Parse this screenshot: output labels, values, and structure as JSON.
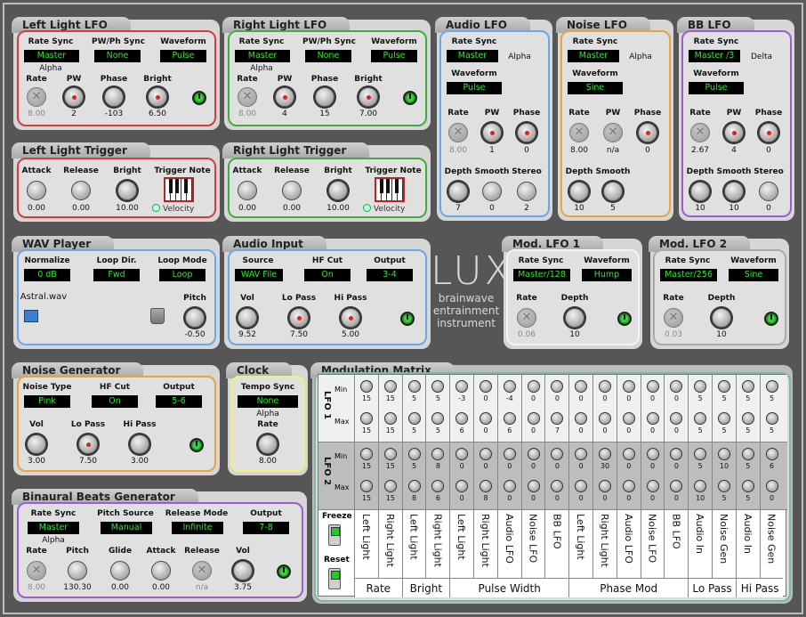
{
  "left_lfo": {
    "title": "Left Light LFO",
    "rate_sync_label": "Rate Sync",
    "rate_sync": "Master",
    "pwph_label": "PW/Ph Sync",
    "pwph": "None",
    "waveform_label": "Waveform",
    "waveform": "Pulse",
    "alpha": "Alpha",
    "rate_label": "Rate",
    "pw_label": "PW",
    "phase_label": "Phase",
    "bright_label": "Bright",
    "rate": "8.00",
    "pw": "2",
    "phase": "-103",
    "bright": "6.50"
  },
  "right_lfo": {
    "title": "Right Light LFO",
    "rate_sync_label": "Rate Sync",
    "rate_sync": "Master",
    "pwph_label": "PW/Ph Sync",
    "pwph": "None",
    "waveform_label": "Waveform",
    "waveform": "Pulse",
    "alpha": "Alpha",
    "rate_label": "Rate",
    "pw_label": "PW",
    "phase_label": "Phase",
    "bright_label": "Bright",
    "rate": "8.00",
    "pw": "4",
    "phase": "15",
    "bright": "7.00"
  },
  "audio_lfo": {
    "title": "Audio LFO",
    "rate_sync_label": "Rate Sync",
    "rate_sync": "Master",
    "alpha": "Alpha",
    "waveform_label": "Waveform",
    "waveform": "Pulse",
    "rate_label": "Rate",
    "pw_label": "PW",
    "phase_label": "Phase",
    "rate": "8.00",
    "pw": "1",
    "phase": "0",
    "depth_label": "Depth",
    "smooth_label": "Smooth",
    "stereo_label": "Stereo",
    "depth": "7",
    "smooth": "0",
    "stereo": "2"
  },
  "noise_lfo": {
    "title": "Noise LFO",
    "rate_sync_label": "Rate Sync",
    "rate_sync": "Master",
    "alpha": "Alpha",
    "waveform_label": "Waveform",
    "waveform": "Sine",
    "rate_label": "Rate",
    "pw_label": "PW",
    "phase_label": "Phase",
    "rate": "8.00",
    "pw": "n/a",
    "phase": "0",
    "depth_label": "Depth",
    "smooth_label": "Smooth",
    "depth": "10",
    "smooth": "5"
  },
  "bb_lfo": {
    "title": "BB LFO",
    "rate_sync_label": "Rate Sync",
    "rate_sync": "Master /3",
    "delta": "Delta",
    "waveform_label": "Waveform",
    "waveform": "Pulse",
    "rate_label": "Rate",
    "pw_label": "PW",
    "phase_label": "Phase",
    "rate": "2.67",
    "pw": "4",
    "phase": "0",
    "depth_label": "Depth",
    "smooth_label": "Smooth",
    "stereo_label": "Stereo",
    "depth": "10",
    "smooth": "10",
    "stereo": "0"
  },
  "left_trig": {
    "title": "Left Light Trigger",
    "attack_label": "Attack",
    "release_label": "Release",
    "bright_label": "Bright",
    "note_label": "Trigger Note",
    "attack": "0.00",
    "release": "0.00",
    "bright": "10.00",
    "velocity": "Velocity"
  },
  "right_trig": {
    "title": "Right Light Trigger",
    "attack_label": "Attack",
    "release_label": "Release",
    "bright_label": "Bright",
    "note_label": "Trigger Note",
    "attack": "0.00",
    "release": "0.00",
    "bright": "10.00",
    "velocity": "Velocity"
  },
  "wav": {
    "title": "WAV Player",
    "normalize_label": "Normalize",
    "normalize": "0 dB",
    "loopdir_label": "Loop Dir.",
    "loopdir": "Fwd",
    "loopmode_label": "Loop Mode",
    "loopmode": "Loop",
    "file": "Astral.wav",
    "pitch_label": "Pitch",
    "pitch": "-0.50"
  },
  "audio_in": {
    "title": "Audio Input",
    "source_label": "Source",
    "source": "WAV File",
    "hfcut_label": "HF Cut",
    "hfcut": "On",
    "output_label": "Output",
    "output": "3-4",
    "vol_label": "Vol",
    "lopass_label": "Lo Pass",
    "hipass_label": "Hi Pass",
    "vol": "9.52",
    "lopass": "7.50",
    "hipass": "5.00"
  },
  "logo": {
    "name": "LUX",
    "line1": "brainwave",
    "line2": "entrainment",
    "line3": "instrument"
  },
  "mod1": {
    "title": "Mod. LFO 1",
    "rate_sync_label": "Rate Sync",
    "rate_sync": "Master/128",
    "waveform_label": "Waveform",
    "waveform": "Hump",
    "rate_label": "Rate",
    "depth_label": "Depth",
    "rate": "0.06",
    "depth": "10"
  },
  "mod2": {
    "title": "Mod. LFO 2",
    "rate_sync_label": "Rate Sync",
    "rate_sync": "Master/256",
    "waveform_label": "Waveform",
    "waveform": "Sine",
    "rate_label": "Rate",
    "depth_label": "Depth",
    "rate": "0.03",
    "depth": "10"
  },
  "noise": {
    "title": "Noise Generator",
    "type_label": "Noise Type",
    "type": "Pink",
    "hfcut_label": "HF Cut",
    "hfcut": "On",
    "output_label": "Output",
    "output": "5-6",
    "vol_label": "Vol",
    "lopass_label": "Lo Pass",
    "hipass_label": "Hi Pass",
    "vol": "3.00",
    "lopass": "7.50",
    "hipass": "3.00"
  },
  "clock": {
    "title": "Clock",
    "tempo_label": "Tempo Sync",
    "tempo": "None",
    "alpha": "Alpha",
    "rate_label": "Rate",
    "rate": "8.00"
  },
  "bb": {
    "title": "Binaural Beats Generator",
    "rate_sync_label": "Rate Sync",
    "rate_sync": "Master",
    "pitchsrc_label": "Pitch Source",
    "pitchsrc": "Manual",
    "relmode_label": "Release Mode",
    "relmode": "Infinite",
    "output_label": "Output",
    "output": "7-8",
    "alpha": "Alpha",
    "rate_label": "Rate",
    "pitch_label": "Pitch",
    "glide_label": "Glide",
    "attack_label": "Attack",
    "release_label": "Release",
    "vol_label": "Vol",
    "rate": "8.00",
    "pitch": "130.30",
    "glide": "0.00",
    "attack": "0.00",
    "release": "n/a",
    "vol": "3.75"
  },
  "matrix": {
    "title": "Modulation Matrix",
    "lfo1": "LFO 1",
    "lfo2": "LFO 2",
    "min": "Min",
    "max": "Max",
    "freeze": "Freeze",
    "reset": "Reset",
    "columns": [
      "Left Light",
      "Right Light",
      "Left Light",
      "Right Light",
      "Left Light",
      "Right Light",
      "Audio LFO",
      "Noise LFO",
      "BB LFO",
      "Left Light",
      "Right Light",
      "Audio LFO",
      "Noise LFO",
      "BB LFO",
      "Audio In",
      "Noise Gen",
      "Audio In",
      "Noise Gen"
    ],
    "lfo1_min": [
      "15",
      "15",
      "5",
      "5",
      "-3",
      "0",
      "-4",
      "0",
      "0",
      "0",
      "0",
      "0",
      "0",
      "0",
      "5",
      "5",
      "5",
      "5"
    ],
    "lfo1_max": [
      "15",
      "15",
      "5",
      "5",
      "6",
      "0",
      "6",
      "0",
      "7",
      "0",
      "0",
      "0",
      "0",
      "0",
      "5",
      "5",
      "5",
      "5"
    ],
    "lfo2_min": [
      "15",
      "15",
      "5",
      "8",
      "0",
      "0",
      "0",
      "0",
      "0",
      "0",
      "30",
      "0",
      "0",
      "0",
      "5",
      "10",
      "5",
      "6"
    ],
    "lfo2_max": [
      "15",
      "15",
      "8",
      "6",
      "0",
      "8",
      "0",
      "0",
      "0",
      "0",
      "0",
      "0",
      "0",
      "0",
      "10",
      "5",
      "5",
      "0"
    ],
    "groups": [
      {
        "label": "Rate",
        "span": 2
      },
      {
        "label": "Bright",
        "span": 2
      },
      {
        "label": "Pulse Width",
        "span": 5
      },
      {
        "label": "Phase Mod",
        "span": 5
      },
      {
        "label": "Lo Pass",
        "span": 2
      },
      {
        "label": "Hi Pass",
        "span": 2
      }
    ]
  }
}
